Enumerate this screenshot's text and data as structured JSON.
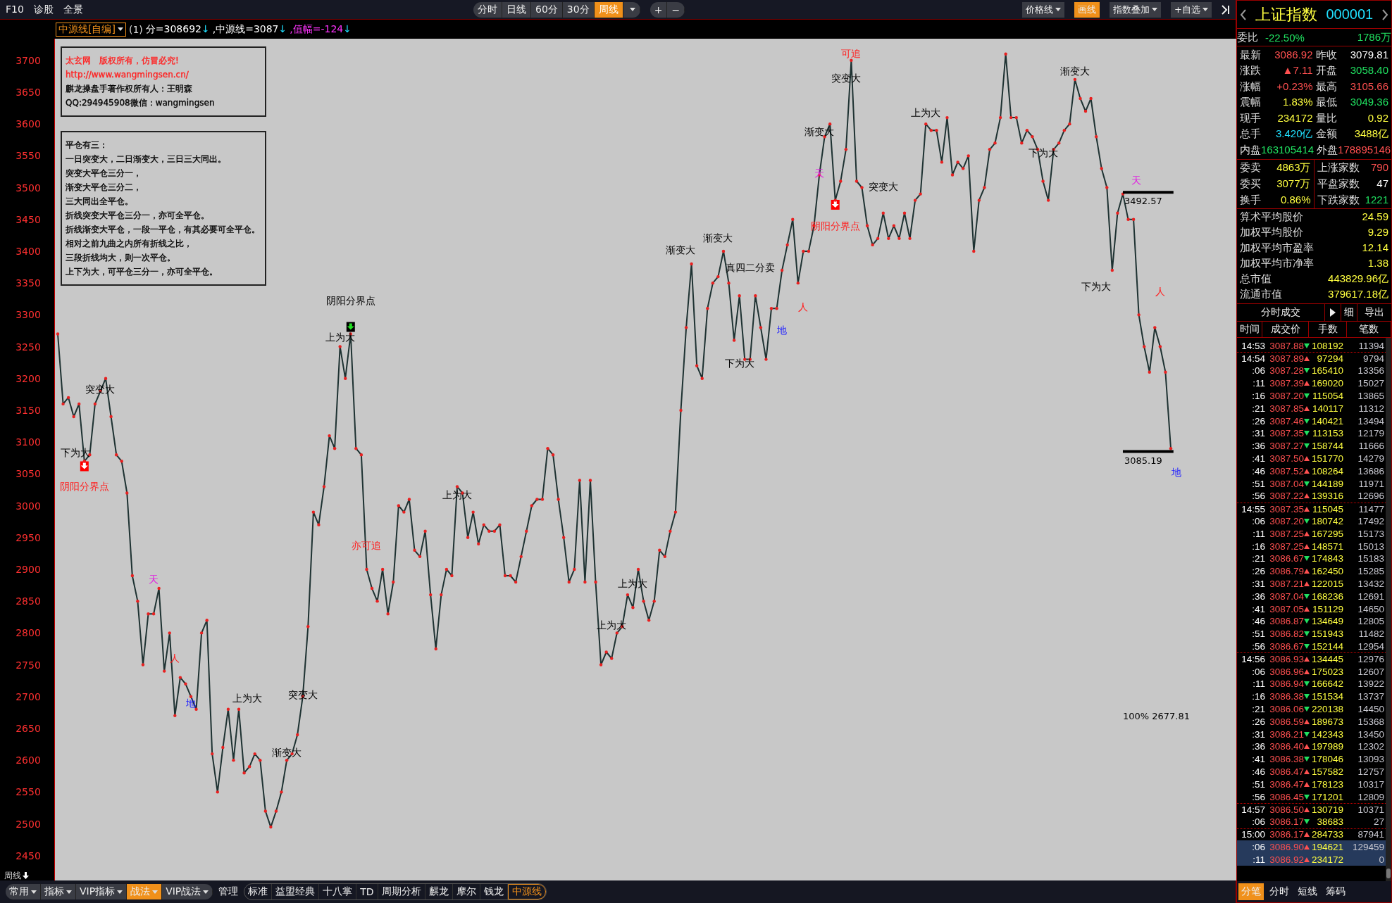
{
  "toolbar": {
    "left": [
      {
        "label": "F10"
      },
      {
        "label": "诊股"
      },
      {
        "label": "全景"
      }
    ],
    "periods": [
      {
        "label": "分时",
        "selected": false
      },
      {
        "label": "日线",
        "selected": false
      },
      {
        "label": "60分",
        "selected": false
      },
      {
        "label": "30分",
        "selected": false
      },
      {
        "label": "周线",
        "selected": true
      }
    ],
    "zoom": [
      {
        "label": "+"
      },
      {
        "label": "−"
      }
    ],
    "right": [
      {
        "label": "价格线",
        "selected": false,
        "dropdown": true
      },
      {
        "label": "画线",
        "selected": true,
        "dropdown": false
      },
      {
        "label": "指数叠加",
        "selected": false,
        "dropdown": true
      },
      {
        "label": "+自选",
        "selected": false,
        "dropdown": true
      }
    ]
  },
  "info": {
    "indicator": "中源线[自编]",
    "param": "(1)",
    "values": [
      {
        "text": "分=308692",
        "arrow": "↓",
        "color": "#ffffff"
      },
      {
        "text": ",中源线=3087",
        "arrow": "↓",
        "color": "#ffffff"
      },
      {
        "text": ",值幅=-124",
        "arrow": "↓",
        "color": "#ff33ff"
      }
    ]
  },
  "notes": [
    {
      "lines": [
        {
          "text": "太玄网　版权所有，仿冒必究!",
          "color": "#ff2020"
        },
        {
          "text": "http://www.wangmingsen.cn/",
          "color": "#ff2020"
        },
        {
          "text": "麒龙操盘手著作权所有人：王明森",
          "color": "#000000"
        },
        {
          "text": "QQ:294945908微信：wangmingsen",
          "color": "#000000"
        }
      ]
    },
    {
      "lines": [
        {
          "text": "平仓有三：",
          "color": "#000000"
        },
        {
          "text": "一日突变大，二日渐变大，三日三大同出。",
          "color": "#000000"
        },
        {
          "text": "突变大平仓三分一，",
          "color": "#000000"
        },
        {
          "text": "渐变大平仓三分二，",
          "color": "#000000"
        },
        {
          "text": "三大同出全平仓。",
          "color": "#000000"
        },
        {
          "text": "折线突变大平仓三分一，亦可全平仓。",
          "color": "#000000"
        },
        {
          "text": "折线渐变大平仓，一段一平仓，有其必要可全平仓。",
          "color": "#000000"
        },
        {
          "text": "相对之前九曲之内所有折线之比，",
          "color": "#000000"
        },
        {
          "text": "三段折线均大，则一次平仓。",
          "color": "#000000"
        },
        {
          "text": "上下为大，可平仓三分一，亦可全平仓。",
          "color": "#000000"
        }
      ]
    }
  ],
  "chart": {
    "chart_data": {
      "type": "line",
      "ylim": [
        2411,
        3734
      ],
      "yticks": [
        2450,
        2500,
        2550,
        2600,
        2650,
        2700,
        2750,
        2800,
        2850,
        2900,
        2950,
        3000,
        3050,
        3100,
        3150,
        3200,
        3250,
        3300,
        3350,
        3400,
        3450,
        3500,
        3550,
        3600,
        3650,
        3700
      ],
      "series": [
        {
          "color": "#1e3232",
          "values": [
            3270,
            3160,
            3170,
            3140,
            3160,
            3070,
            3080,
            3160,
            3180,
            3200,
            3140,
            3080,
            3070,
            3020,
            2890,
            2850,
            2750,
            2830,
            2830,
            2870,
            2740,
            2800,
            2670,
            2730,
            2720,
            2700,
            2680,
            2800,
            2820,
            2610,
            2550,
            2620,
            2680,
            2600,
            2680,
            2580,
            2590,
            2610,
            2600,
            2520,
            2495,
            2520,
            2550,
            2600,
            2610,
            2640,
            2700,
            2810,
            2990,
            2970,
            3030,
            3110,
            3090,
            3250,
            3200,
            3270,
            3090,
            3080,
            2900,
            2870,
            2850,
            2900,
            2830,
            2880,
            3000,
            2990,
            3010,
            2930,
            2920,
            2960,
            2860,
            2775,
            2860,
            2900,
            2890,
            3030,
            3020,
            2950,
            2990,
            2940,
            2970,
            2960,
            2960,
            2970,
            2890,
            2890,
            2880,
            2920,
            2960,
            3000,
            3010,
            3010,
            3090,
            3080,
            3010,
            2950,
            2880,
            2900,
            3040,
            2880,
            3040,
            2880,
            2750,
            2770,
            2760,
            2800,
            2810,
            2860,
            2840,
            2900,
            2850,
            2820,
            2850,
            2930,
            2920,
            2960,
            2990,
            3150,
            3280,
            3380,
            3220,
            3200,
            3310,
            3350,
            3360,
            3400,
            3350,
            3260,
            3330,
            3230,
            3230,
            3330,
            3280,
            3230,
            3310,
            3310,
            3370,
            3410,
            3450,
            3350,
            3400,
            3400,
            3440,
            3520,
            3580,
            3600,
            3480,
            3510,
            3560,
            3700,
            3510,
            3500,
            3440,
            3410,
            3420,
            3460,
            3420,
            3440,
            3420,
            3460,
            3420,
            3480,
            3490,
            3600,
            3590,
            3590,
            3540,
            3610,
            3520,
            3540,
            3530,
            3550,
            3400,
            3480,
            3500,
            3560,
            3570,
            3610,
            3710,
            3610,
            3610,
            3570,
            3590,
            3580,
            3560,
            3510,
            3480,
            3560,
            3570,
            3590,
            3600,
            3670,
            3640,
            3620,
            3640,
            3580,
            3530,
            3500,
            3370,
            3460,
            3490,
            3450,
            3450,
            3300,
            3250,
            3210,
            3280,
            3250,
            3210,
            3090
          ]
        }
      ]
    },
    "labels": [
      {
        "text": "突变大",
        "color": "#000000"
      },
      {
        "text": "下为大",
        "color": "#000000"
      },
      {
        "text": "阴阳分界点",
        "color": "#ff2020"
      },
      {
        "text": "天",
        "color": "#e020e0"
      },
      {
        "text": "人",
        "color": "#ff2020"
      },
      {
        "text": "地",
        "color": "#2020ff"
      },
      {
        "text": "上为大",
        "color": "#000000"
      },
      {
        "text": "突变大",
        "color": "#000000"
      },
      {
        "text": "渐变大",
        "color": "#000000"
      },
      {
        "text": "阴阳分界点",
        "color": "#000000"
      },
      {
        "text": "上为大",
        "color": "#000000"
      },
      {
        "text": "亦可追",
        "color": "#ff2020"
      },
      {
        "text": "上为大",
        "color": "#000000"
      },
      {
        "text": "上为大",
        "color": "#000000"
      },
      {
        "text": "上为大",
        "color": "#000000"
      },
      {
        "text": "渐变大",
        "color": "#000000"
      },
      {
        "text": "渐变大",
        "color": "#000000"
      },
      {
        "text": "真四二分卖",
        "color": "#000000"
      },
      {
        "text": "下为大",
        "color": "#000000"
      },
      {
        "text": "人",
        "color": "#ff2020"
      },
      {
        "text": "地",
        "color": "#2020ff"
      },
      {
        "text": "可追",
        "color": "#ff2020"
      },
      {
        "text": "突变大",
        "color": "#000000"
      },
      {
        "text": "渐变大",
        "color": "#000000"
      },
      {
        "text": "天",
        "color": "#e020e0"
      },
      {
        "text": "阴阳分界点",
        "color": "#ff2020"
      },
      {
        "text": "突变大",
        "color": "#000000"
      },
      {
        "text": "上为大",
        "color": "#000000"
      },
      {
        "text": "渐变大",
        "color": "#000000"
      },
      {
        "text": "下为大",
        "color": "#000000"
      },
      {
        "text": "下为大",
        "color": "#000000"
      },
      {
        "text": "人",
        "color": "#ff2020"
      },
      {
        "text": "地",
        "color": "#2020ff"
      },
      {
        "text": "天",
        "color": "#e020e0"
      }
    ],
    "markers": [
      {
        "color": "#ff0000"
      },
      {
        "color": "#000000"
      },
      {
        "color": "#ff0000"
      }
    ],
    "levels": [
      {
        "text": "3492.57"
      },
      {
        "text": "3085.19"
      }
    ],
    "scale_note": "100% 2677.81"
  },
  "period_label": "周线",
  "bottom_bar": {
    "groups": [
      {
        "label": "常用",
        "selected": false
      },
      {
        "label": "指标",
        "selected": false
      },
      {
        "label": "VIP指标",
        "selected": false
      },
      {
        "label": "战法",
        "selected": true
      },
      {
        "label": "VIP战法",
        "selected": false
      }
    ],
    "manage": "管理",
    "templates": [
      {
        "label": "标准",
        "selected": false
      },
      {
        "label": "益盟经典",
        "selected": false
      },
      {
        "label": "十八掌",
        "selected": false
      },
      {
        "label": "TD",
        "selected": false
      },
      {
        "label": "周期分析",
        "selected": false
      },
      {
        "label": "麒龙",
        "selected": false
      },
      {
        "label": "摩尔",
        "selected": false
      },
      {
        "label": "钱龙",
        "selected": false
      },
      {
        "label": "中源线",
        "selected": true
      }
    ]
  },
  "quote": {
    "name": "上证指数",
    "code": "000001",
    "ratio": {
      "label": "委比",
      "value": "-22.50%",
      "extra": "1786万",
      "color": "#20e060"
    },
    "pairs": [
      [
        {
          "label": "最新",
          "value": "3086.92",
          "color": "#ff5050"
        },
        {
          "label": "昨收",
          "value": "3079.81",
          "color": "#ffffff"
        }
      ],
      [
        {
          "label": "涨跌",
          "value": "▲7.11",
          "color": "#ff5050"
        },
        {
          "label": "开盘",
          "value": "3058.40",
          "color": "#20e060"
        }
      ],
      [
        {
          "label": "涨幅",
          "value": "+0.23%",
          "color": "#ff5050"
        },
        {
          "label": "最高",
          "value": "3105.66",
          "color": "#ff5050"
        }
      ],
      [
        {
          "label": "震幅",
          "value": "1.83%",
          "color": "#ffff40"
        },
        {
          "label": "最低",
          "value": "3049.36",
          "color": "#20e060"
        }
      ],
      [
        {
          "label": "现手",
          "value": "234172",
          "color": "#ffff40"
        },
        {
          "label": "量比",
          "value": "0.92",
          "color": "#ffff40"
        }
      ],
      [
        {
          "label": "总手",
          "value": "3.420亿",
          "color": "#20e0ff"
        },
        {
          "label": "金额",
          "value": "3488亿",
          "color": "#ffff40"
        }
      ],
      [
        {
          "label": "内盘",
          "value": "163105414",
          "color": "#20e060"
        },
        {
          "label": "外盘",
          "value": "178895146",
          "color": "#ff5050"
        }
      ]
    ],
    "orders": [
      [
        {
          "label": "委卖",
          "value": "4863万",
          "color": "#ffff40"
        },
        {
          "label": "上涨家数",
          "value": "790",
          "color": "#ff5050"
        }
      ],
      [
        {
          "label": "委买",
          "value": "3077万",
          "color": "#ffff40"
        },
        {
          "label": "平盘家数",
          "value": "47",
          "color": "#ffffff"
        }
      ],
      [
        {
          "label": "换手",
          "value": "0.86%",
          "color": "#ffff40"
        },
        {
          "label": "下跌家数",
          "value": "1221",
          "color": "#20e060"
        }
      ]
    ],
    "stats": [
      {
        "label": "算术平均股价",
        "value": "24.59"
      },
      {
        "label": "加权平均股价",
        "value": "9.29"
      },
      {
        "label": "加权平均市盈率",
        "value": "12.14"
      },
      {
        "label": "加权平均市净率",
        "value": "1.38"
      },
      {
        "label": "总市值",
        "value": "443829.96亿"
      },
      {
        "label": "流通市值",
        "value": "379617.18亿"
      }
    ]
  },
  "ticks": {
    "title": "分时成交",
    "detail": "细",
    "export": "导出",
    "columns": [
      "时间",
      "成交价",
      "手数",
      "笔数"
    ],
    "rows": [
      {
        "time": "14:53",
        "price": "3087.88",
        "rising": false,
        "volume": "108192",
        "count": "11394",
        "break_before": false,
        "selected": false
      },
      {
        "time": "14:54",
        "price": "3087.89",
        "rising": true,
        "volume": "97294",
        "count": "9794",
        "break_before": true,
        "selected": false
      },
      {
        "time": ":06",
        "price": "3087.28",
        "rising": false,
        "volume": "165410",
        "count": "13356",
        "break_before": false,
        "selected": false
      },
      {
        "time": ":11",
        "price": "3087.39",
        "rising": true,
        "volume": "169020",
        "count": "15027",
        "break_before": false,
        "selected": false
      },
      {
        "time": ":16",
        "price": "3087.20",
        "rising": false,
        "volume": "115054",
        "count": "13865",
        "break_before": false,
        "selected": false
      },
      {
        "time": ":21",
        "price": "3087.85",
        "rising": true,
        "volume": "140117",
        "count": "11312",
        "break_before": false,
        "selected": false
      },
      {
        "time": ":26",
        "price": "3087.46",
        "rising": false,
        "volume": "140421",
        "count": "13494",
        "break_before": false,
        "selected": false
      },
      {
        "time": ":31",
        "price": "3087.35",
        "rising": false,
        "volume": "113153",
        "count": "12179",
        "break_before": false,
        "selected": false
      },
      {
        "time": ":36",
        "price": "3087.27",
        "rising": false,
        "volume": "158744",
        "count": "11666",
        "break_before": false,
        "selected": false
      },
      {
        "time": ":41",
        "price": "3087.50",
        "rising": true,
        "volume": "151770",
        "count": "14279",
        "break_before": false,
        "selected": false
      },
      {
        "time": ":46",
        "price": "3087.52",
        "rising": true,
        "volume": "108264",
        "count": "13686",
        "break_before": false,
        "selected": false
      },
      {
        "time": ":51",
        "price": "3087.04",
        "rising": false,
        "volume": "144189",
        "count": "11971",
        "break_before": false,
        "selected": false
      },
      {
        "time": ":56",
        "price": "3087.22",
        "rising": true,
        "volume": "139316",
        "count": "12696",
        "break_before": false,
        "selected": false
      },
      {
        "time": "14:55",
        "price": "3087.35",
        "rising": true,
        "volume": "115045",
        "count": "11477",
        "break_before": true,
        "selected": false
      },
      {
        "time": ":06",
        "price": "3087.20",
        "rising": false,
        "volume": "180742",
        "count": "17492",
        "break_before": false,
        "selected": false
      },
      {
        "time": ":11",
        "price": "3087.25",
        "rising": true,
        "volume": "167295",
        "count": "15173",
        "break_before": false,
        "selected": false
      },
      {
        "time": ":16",
        "price": "3087.25",
        "rising": true,
        "volume": "148571",
        "count": "15013",
        "break_before": false,
        "selected": false
      },
      {
        "time": ":21",
        "price": "3086.67",
        "rising": false,
        "volume": "174843",
        "count": "15183",
        "break_before": false,
        "selected": false
      },
      {
        "time": ":26",
        "price": "3086.79",
        "rising": true,
        "volume": "162450",
        "count": "15285",
        "break_before": false,
        "selected": false
      },
      {
        "time": ":31",
        "price": "3087.21",
        "rising": true,
        "volume": "122015",
        "count": "13432",
        "break_before": false,
        "selected": false
      },
      {
        "time": ":36",
        "price": "3087.04",
        "rising": false,
        "volume": "168236",
        "count": "12691",
        "break_before": false,
        "selected": false
      },
      {
        "time": ":41",
        "price": "3087.05",
        "rising": true,
        "volume": "151129",
        "count": "14650",
        "break_before": false,
        "selected": false
      },
      {
        "time": ":46",
        "price": "3086.87",
        "rising": false,
        "volume": "134649",
        "count": "12805",
        "break_before": false,
        "selected": false
      },
      {
        "time": ":51",
        "price": "3086.82",
        "rising": false,
        "volume": "151943",
        "count": "11482",
        "break_before": false,
        "selected": false
      },
      {
        "time": ":56",
        "price": "3086.67",
        "rising": false,
        "volume": "152144",
        "count": "12954",
        "break_before": false,
        "selected": false
      },
      {
        "time": "14:56",
        "price": "3086.93",
        "rising": true,
        "volume": "134445",
        "count": "12976",
        "break_before": true,
        "selected": false
      },
      {
        "time": ":06",
        "price": "3086.96",
        "rising": true,
        "volume": "175023",
        "count": "12607",
        "break_before": false,
        "selected": false
      },
      {
        "time": ":11",
        "price": "3086.94",
        "rising": false,
        "volume": "166642",
        "count": "13922",
        "break_before": false,
        "selected": false
      },
      {
        "time": ":16",
        "price": "3086.38",
        "rising": false,
        "volume": "151534",
        "count": "13737",
        "break_before": false,
        "selected": false
      },
      {
        "time": ":21",
        "price": "3086.06",
        "rising": false,
        "volume": "220138",
        "count": "14450",
        "break_before": false,
        "selected": false
      },
      {
        "time": ":26",
        "price": "3086.59",
        "rising": true,
        "volume": "189673",
        "count": "15368",
        "break_before": false,
        "selected": false
      },
      {
        "time": ":31",
        "price": "3086.21",
        "rising": false,
        "volume": "142343",
        "count": "13450",
        "break_before": false,
        "selected": false
      },
      {
        "time": ":36",
        "price": "3086.40",
        "rising": true,
        "volume": "197989",
        "count": "12302",
        "break_before": false,
        "selected": false
      },
      {
        "time": ":41",
        "price": "3086.38",
        "rising": false,
        "volume": "178046",
        "count": "13093",
        "break_before": false,
        "selected": false
      },
      {
        "time": ":46",
        "price": "3086.47",
        "rising": true,
        "volume": "157582",
        "count": "12757",
        "break_before": false,
        "selected": false
      },
      {
        "time": ":51",
        "price": "3086.47",
        "rising": true,
        "volume": "178123",
        "count": "10317",
        "break_before": false,
        "selected": false
      },
      {
        "time": ":56",
        "price": "3086.45",
        "rising": false,
        "volume": "171201",
        "count": "12809",
        "break_before": false,
        "selected": false
      },
      {
        "time": "14:57",
        "price": "3086.50",
        "rising": true,
        "volume": "130719",
        "count": "10371",
        "break_before": true,
        "selected": false
      },
      {
        "time": ":06",
        "price": "3086.17",
        "rising": false,
        "volume": "38683",
        "count": "27",
        "break_before": false,
        "selected": false
      },
      {
        "time": "15:00",
        "price": "3086.17",
        "rising": true,
        "volume": "284733",
        "count": "87941",
        "break_before": true,
        "selected": false
      },
      {
        "time": ":06",
        "price": "3086.90",
        "rising": true,
        "volume": "194621",
        "count": "129459",
        "break_before": false,
        "selected": true
      },
      {
        "time": ":11",
        "price": "3086.92",
        "rising": true,
        "volume": "234172",
        "count": "0",
        "break_before": false,
        "selected": true
      }
    ]
  },
  "panel_tabs": [
    {
      "label": "分笔",
      "selected": true
    },
    {
      "label": "分时",
      "selected": false
    },
    {
      "label": "短线",
      "selected": false
    },
    {
      "label": "筹码",
      "selected": false
    }
  ]
}
